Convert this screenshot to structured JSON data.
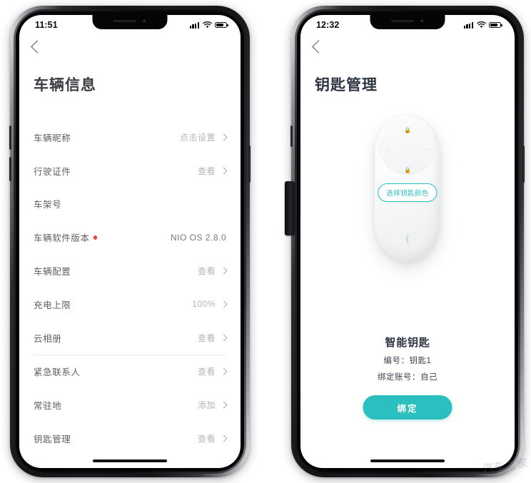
{
  "phones": [
    {
      "id": "vehicle-info",
      "statusbar": {
        "time": "11:51",
        "signal_icon": "signal-bars-icon",
        "wifi_icon": "wifi-icon",
        "battery_icon": "battery-icon"
      },
      "back_label": "back-chevron",
      "title": "车辆信息",
      "rows": [
        {
          "label": "车辆昵称",
          "value": "点击设置",
          "chevron": true,
          "badge": false,
          "dark": false
        },
        {
          "label": "行驶证件",
          "value": "查看",
          "chevron": true,
          "badge": false,
          "dark": false
        },
        {
          "label": "车架号",
          "value": "",
          "chevron": false,
          "badge": false,
          "dark": false
        },
        {
          "label": "车辆软件版本",
          "value": "NIO OS 2.8.0",
          "chevron": false,
          "badge": true,
          "dark": true
        },
        {
          "label": "车辆配置",
          "value": "查看",
          "chevron": true,
          "badge": false,
          "dark": false
        },
        {
          "label": "充电上限",
          "value": "100%",
          "chevron": true,
          "badge": false,
          "dark": false
        },
        {
          "label": "云相册",
          "value": "查看",
          "chevron": true,
          "badge": false,
          "dark": false
        },
        {
          "label": "紧急联系人",
          "value": "查看",
          "chevron": true,
          "badge": false,
          "dark": false
        },
        {
          "label": "常驻地",
          "value": "添加",
          "chevron": true,
          "badge": false,
          "dark": false
        },
        {
          "label": "钥匙管理",
          "value": "查看",
          "chevron": true,
          "badge": false,
          "dark": false
        }
      ],
      "divider_after_index": 6
    },
    {
      "id": "key-management",
      "statusbar": {
        "time": "12:32",
        "signal_icon": "signal-bars-icon",
        "wifi_icon": "wifi-icon",
        "battery_icon": "battery-icon"
      },
      "back_label": "back-chevron",
      "title": "钥匙管理",
      "key": {
        "color_pill_label": "选择钥匙颜色",
        "name": "智能钥匙",
        "number_line": "编号：钥匙1",
        "account_line": "绑定账号：自己",
        "bind_button_label": "绑定",
        "fob_icons": [
          "lock-icon",
          "unlock-icon",
          "trunk-icon",
          "lock-small-icon",
          "brand-logo-icon"
        ]
      }
    }
  ],
  "colors": {
    "accent_teal": "#2bbfc0",
    "badge_red": "#e8453c",
    "title_gray": "#3c3d41",
    "title_navy": "#2e3642",
    "label_gray": "#5f6064",
    "value_gray": "#b3b4b7"
  },
  "watermark": {
    "text": "汽车之家"
  }
}
